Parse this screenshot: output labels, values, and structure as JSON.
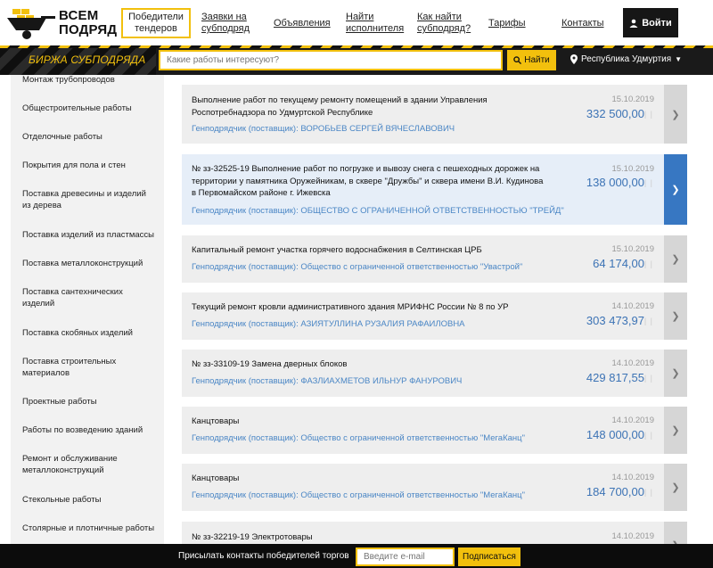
{
  "logo": {
    "text": "ВСЕМ ПОДРЯД"
  },
  "nav": {
    "items": [
      {
        "label": "Победители\nтендеров",
        "active": true
      },
      {
        "label": "Заявки на\nсубподряд"
      },
      {
        "label": "Объявления"
      },
      {
        "label": "Найти\nисполнителя"
      },
      {
        "label": "Как найти\nсубподряд?"
      },
      {
        "label": "Тарифы"
      },
      {
        "label": "Контакты"
      }
    ],
    "login_label": "Войти"
  },
  "topbar": {
    "brand": "Биржа субподряда",
    "search_placeholder": "Какие работы интересуют?",
    "search_button": "Найти",
    "region": "Республика Удмуртия"
  },
  "sidebar": {
    "items": [
      "Монтаж трубопроводов",
      "Общестроительные работы",
      "Отделочные работы",
      "Покрытия для пола и стен",
      "Поставка древесины и изделий из дерева",
      "Поставка изделий из пластмассы",
      "Поставка металлоконструкций",
      "Поставка сантехнических изделий",
      "Поставка скобяных изделий",
      "Поставка строительных материалов",
      "Проектные работы",
      "Работы по возведению зданий",
      "Ремонт и обслуживание металлоконструкций",
      "Стекольные работы",
      "Столярные и плотничные работы"
    ]
  },
  "listings": [
    {
      "title": "Выполнение работ по текущему ремонту помещений в здании Управления Роспотребнадзора по Удмуртской Республике",
      "contractor": "Генподрядчик (поставщик): ВОРОБЬЕВ СЕРГЕЙ ВЯЧЕСЛАВОВИЧ",
      "date": "15.10.2019",
      "price": "332 500,00"
    },
    {
      "title": "№ зз-32525-19 Выполнение работ по погрузке и вывозу снега с пешеходных дорожек на территории у памятника Оружейникам, в сквере \"Дружбы\" и сквера имени В.И. Кудинова в Первомайском районе г. Ижевска",
      "contractor": "Генподрядчик (поставщик): ОБЩЕСТВО С ОГРАНИЧЕННОЙ ОТВЕТСТВЕННОСТЬЮ \"ТРЕЙД\"",
      "date": "15.10.2019",
      "price": "138 000,00",
      "highlighted": true
    },
    {
      "title": "Капитальный ремонт участка горячего водоснабжения в Селтинская ЦРБ",
      "contractor": "Генподрядчик (поставщик): Общество с ограниченной ответственностью \"Увастрой\"",
      "date": "15.10.2019",
      "price": "64 174,00"
    },
    {
      "title": "Текущий ремонт кровли административного здания МРИФНС России № 8 по УР",
      "contractor": "Генподрядчик (поставщик): АЗИЯТУЛЛИНА РУЗАЛИЯ РАФАИЛОВНА",
      "date": "14.10.2019",
      "price": "303 473,97"
    },
    {
      "title": "№ зз-33109-19 Замена дверных блоков",
      "contractor": "Генподрядчик (поставщик): ФАЗЛИАХМЕТОВ ИЛЬНУР ФАНУРОВИЧ",
      "date": "14.10.2019",
      "price": "429 817,55"
    },
    {
      "title": "Канцтовары",
      "contractor": "Генподрядчик (поставщик): Общество с ограниченной ответственностью \"МегаКанц\"",
      "date": "14.10.2019",
      "price": "148 000,00"
    },
    {
      "title": "Канцтовары",
      "contractor": "Генподрядчик (поставщик): Общество с ограниченной ответственностью \"МегаКанц\"",
      "date": "14.10.2019",
      "price": "184 700,00"
    },
    {
      "title": "№ зз-32219-19 Электротовары",
      "contractor": "",
      "date": "14.10.2019",
      "price": ""
    }
  ],
  "footer": {
    "text": "Присылать контакты победителей торгов",
    "email_placeholder": "Введите e-mail",
    "subscribe_label": "Подписаться"
  },
  "colors": {
    "accent": "#f2c00d",
    "link": "#4a86c5",
    "price": "#3c73b5",
    "highlight": "#3777c2"
  }
}
